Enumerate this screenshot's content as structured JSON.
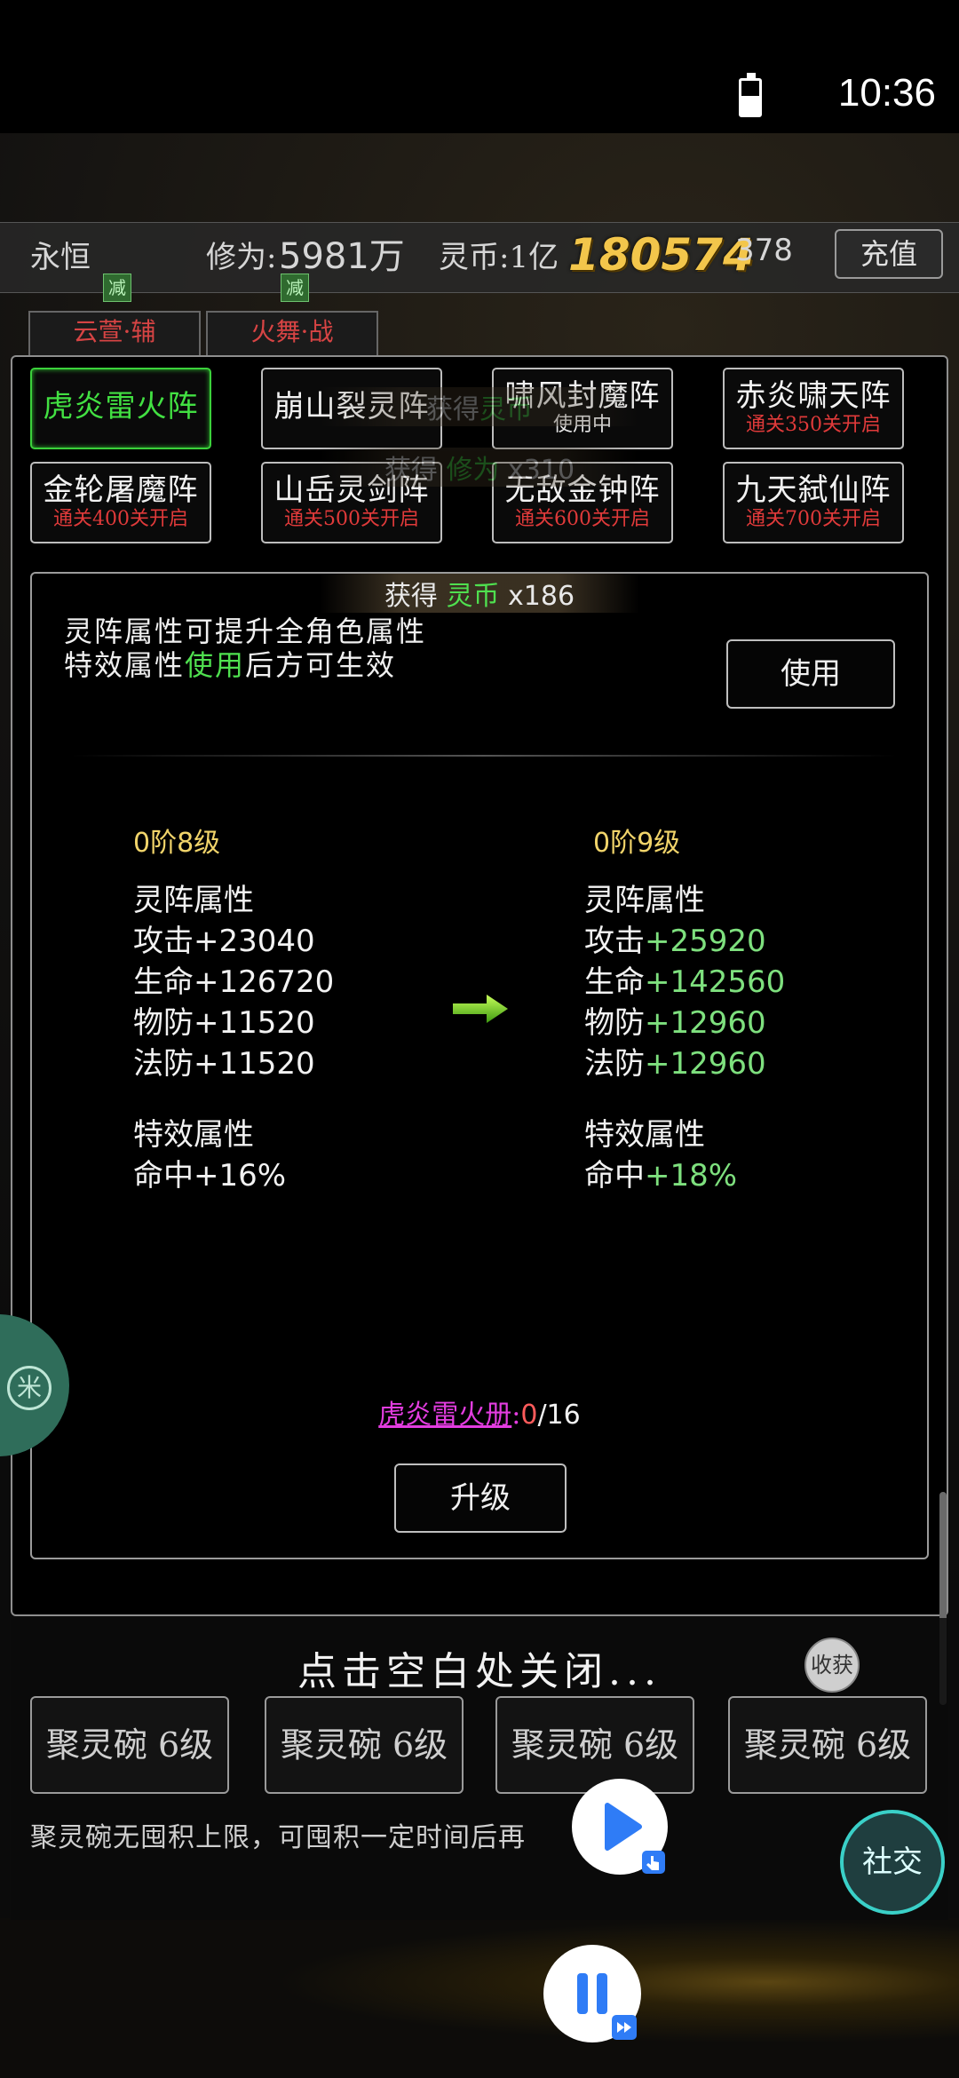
{
  "status_bar": {
    "time": "10:36"
  },
  "top_bar": {
    "name": "永恒",
    "cultivation_label": "修为:",
    "cultivation_value": "5981万",
    "coin_label": "灵币:1亿",
    "float_number": "180574",
    "right_partial": "378",
    "recharge_label": "充值"
  },
  "heroes": [
    {
      "label": "云萱·辅",
      "badge": "减"
    },
    {
      "label": "火舞·战",
      "badge": "减"
    }
  ],
  "tabs": [
    {
      "name": "虎炎雷火阵",
      "sub": "",
      "active": true
    },
    {
      "name": "崩山裂灵阵",
      "sub": ""
    },
    {
      "name": "啸风封魔阵",
      "sub": "使用中"
    },
    {
      "name": "赤炎啸天阵",
      "sub": "通关350关开启"
    },
    {
      "name": "金轮屠魔阵",
      "sub": "通关400关开启"
    },
    {
      "name": "山岳灵剑阵",
      "sub": "通关500关开启"
    },
    {
      "name": "无敌金钟阵",
      "sub": "通关600关开启"
    },
    {
      "name": "九天弑仙阵",
      "sub": "通关700关开启"
    }
  ],
  "toasts": {
    "t1": {
      "prefix": "获得",
      "item": "灵币",
      "count": "x186"
    },
    "t2": {
      "prefix": "获得",
      "item": "修为",
      "count": "x310"
    },
    "t3": {
      "prefix": "获得",
      "item": "灵币",
      "count": ""
    }
  },
  "description": {
    "line1": "灵阵属性可提升全角色属性",
    "line2_a": "特效属性",
    "line2_b": "使用",
    "line2_c": "后方可生效",
    "use_button": "使用"
  },
  "current": {
    "level": "0阶8级",
    "attr_title": "灵阵属性",
    "stats": [
      {
        "label": "攻击",
        "value": "+23040"
      },
      {
        "label": "生命",
        "value": "+126720"
      },
      {
        "label": "物防",
        "value": "+11520"
      },
      {
        "label": "法防",
        "value": "+11520"
      }
    ],
    "effect_title": "特效属性",
    "effect": {
      "label": "命中",
      "value": "+16%"
    }
  },
  "next": {
    "level": "0阶9级",
    "attr_title": "灵阵属性",
    "stats": [
      {
        "label": "攻击",
        "value": "+25920"
      },
      {
        "label": "生命",
        "value": "+142560"
      },
      {
        "label": "物防",
        "value": "+12960"
      },
      {
        "label": "法防",
        "value": "+12960"
      }
    ],
    "effect_title": "特效属性",
    "effect": {
      "label": "命中",
      "value": "+18%"
    }
  },
  "book": {
    "name": "虎炎雷火册",
    "sep": ":",
    "current": "0",
    "total": "/16"
  },
  "upgrade_button": "升级",
  "close_hint": "点击空白处关闭...",
  "harvest_label": "收获",
  "bowls": [
    "聚灵碗 6级",
    "聚灵碗 6级",
    "聚灵碗 6级",
    "聚灵碗 6级"
  ],
  "bowl_note": "聚灵碗无囤积上限，可囤积一定时间后再",
  "side_icon": "米",
  "social_label": "社交",
  "colors": {
    "active_green": "#42e042",
    "locked_red": "#e03a3a",
    "gain_green": "#7ee07e",
    "level_gold": "#f1d46a",
    "book_magenta": "#e33de0"
  },
  "icons": [
    "battery-icon",
    "upgrade-arrow-icon",
    "play-icon",
    "pause-icon",
    "fast-forward-icon",
    "touch-hand-icon"
  ]
}
